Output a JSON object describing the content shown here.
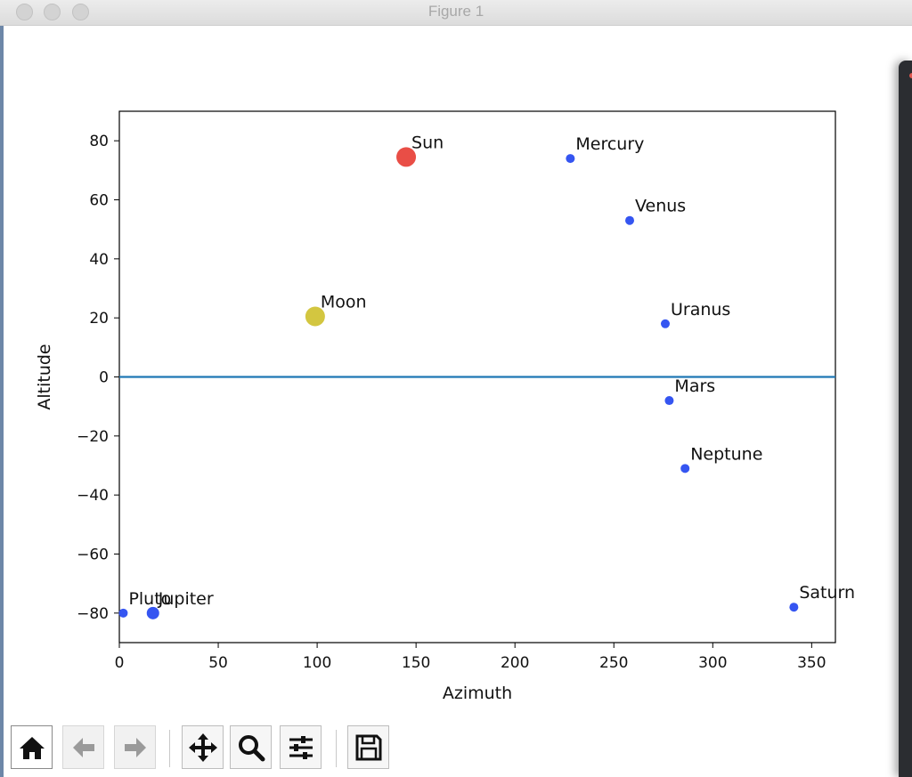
{
  "window": {
    "title": "Figure 1"
  },
  "toolbar": {
    "buttons": [
      {
        "name": "home-button",
        "icon": "home-icon"
      },
      {
        "name": "back-button",
        "icon": "arrow-left-icon"
      },
      {
        "name": "forward-button",
        "icon": "arrow-right-icon"
      },
      {
        "name": "pan-button",
        "icon": "move-icon"
      },
      {
        "name": "zoom-button",
        "icon": "magnifier-icon"
      },
      {
        "name": "subplots-button",
        "icon": "sliders-icon"
      },
      {
        "name": "save-button",
        "icon": "floppy-disk-icon"
      }
    ]
  },
  "chart_data": {
    "type": "scatter",
    "title": "",
    "xlabel": "Azimuth",
    "ylabel": "Altitude",
    "xlim": [
      0,
      362
    ],
    "ylim": [
      -90,
      90
    ],
    "xticks": [
      0,
      50,
      100,
      150,
      200,
      250,
      300,
      350
    ],
    "yticks": [
      80,
      60,
      40,
      20,
      0,
      -20,
      -40,
      -60,
      -80
    ],
    "xtick_labels": [
      "0",
      "50",
      "100",
      "150",
      "200",
      "250",
      "300",
      "350"
    ],
    "ytick_labels": [
      "80",
      "60",
      "40",
      "20",
      "0",
      "−20",
      "−40",
      "−60",
      "−80"
    ],
    "grid": false,
    "horizon_line": {
      "y": 0,
      "color": "#1f77b4"
    },
    "points": [
      {
        "label": "Sun",
        "x": 145,
        "y": 74.5,
        "size": "large",
        "color": "#e8453c"
      },
      {
        "label": "Mercury",
        "x": 228,
        "y": 74,
        "size": "small",
        "color": "#2a4cf0"
      },
      {
        "label": "Venus",
        "x": 258,
        "y": 53,
        "size": "small",
        "color": "#2a4cf0"
      },
      {
        "label": "Moon",
        "x": 99,
        "y": 20.5,
        "size": "large",
        "color": "#d1c336"
      },
      {
        "label": "Uranus",
        "x": 276,
        "y": 18,
        "size": "small",
        "color": "#2a4cf0"
      },
      {
        "label": "Mars",
        "x": 278,
        "y": -8,
        "size": "small",
        "color": "#2a4cf0"
      },
      {
        "label": "Neptune",
        "x": 286,
        "y": -31,
        "size": "small",
        "color": "#2a4cf0"
      },
      {
        "label": "Saturn",
        "x": 341,
        "y": -78,
        "size": "small",
        "color": "#2a4cf0"
      },
      {
        "label": "Pluto",
        "x": 2,
        "y": -80,
        "size": "small",
        "color": "#2a4cf0"
      },
      {
        "label": "Jupiter",
        "x": 17,
        "y": -80,
        "size": "medium",
        "color": "#2a4cf0"
      }
    ]
  }
}
